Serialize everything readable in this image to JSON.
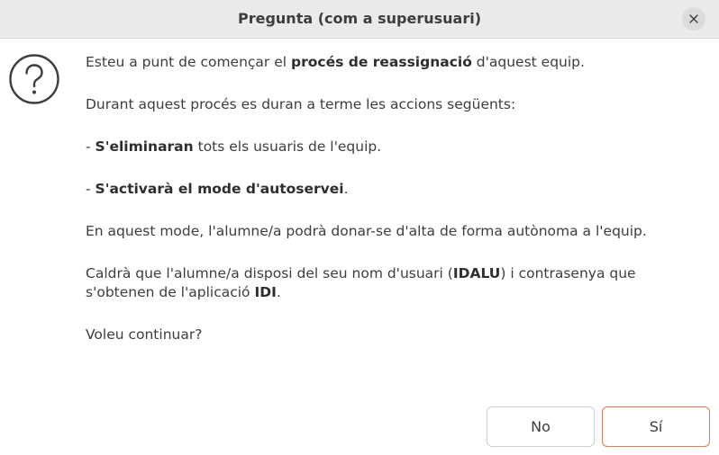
{
  "window": {
    "title": "Pregunta (com a superusuari)",
    "close_icon": "close-icon"
  },
  "dialog": {
    "icon": "question-icon",
    "p1_pre": "Esteu a punt de començar el ",
    "p1_bold": "procés de reassignació",
    "p1_post": " d'aquest equip.",
    "p2": "Durant aquest procés es duran a terme les accions següents:",
    "p3_pre": "- ",
    "p3_bold": "S'eliminaran",
    "p3_post": " tots els usuaris de l'equip.",
    "p4_pre": "- ",
    "p4_bold": "S'activarà el mode d'autoservei",
    "p4_post": ".",
    "p5": "En aquest mode, l'alumne/a podrà donar-se d'alta de forma autònoma a l'equip.",
    "p6_pre": "Caldrà que l'alumne/a disposi del seu nom d'usuari (",
    "p6_bold1": "IDALU",
    "p6_mid": ") i contrasenya que s'obtenen de l'aplicació ",
    "p6_bold2": "IDI",
    "p6_post": ".",
    "p7": "Voleu continuar?"
  },
  "buttons": {
    "no_label": "No",
    "yes_label": "Sí"
  },
  "colors": {
    "accent_border": "#e07a52",
    "titlebar_bg": "#ebebeb"
  }
}
